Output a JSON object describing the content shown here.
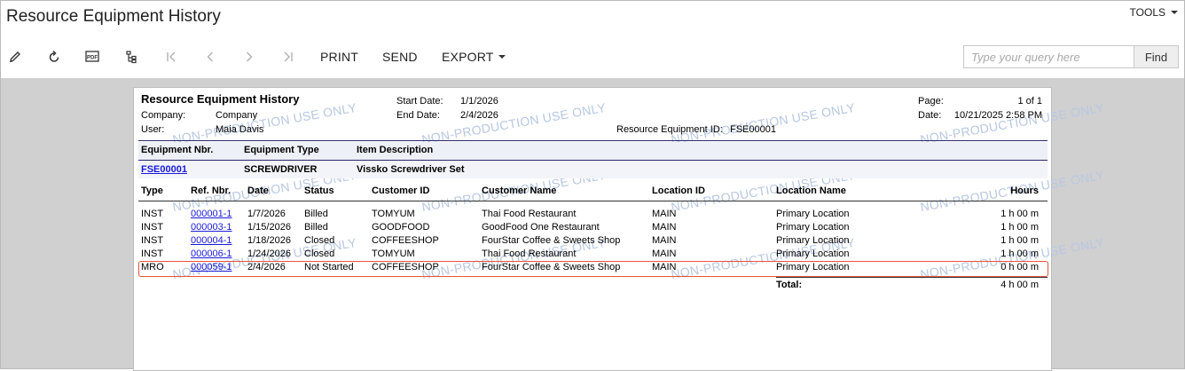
{
  "window": {
    "title": "Resource Equipment History",
    "tools_label": "TOOLS"
  },
  "toolbar": {
    "icons": [
      "edit-icon",
      "refresh-icon",
      "pdf-icon",
      "tree-icon",
      "first-icon",
      "previous-icon",
      "next-icon",
      "last-icon"
    ],
    "print_label": "PRINT",
    "send_label": "SEND",
    "export_label": "EXPORT",
    "search_placeholder": "Type your query here",
    "find_label": "Find"
  },
  "report": {
    "title": "Resource Equipment History",
    "watermark": "NON-PRODUCTION USE ONLY",
    "header": {
      "company_label": "Company:",
      "company_value": "Company",
      "user_label": "User:",
      "user_value": "Maia Davis",
      "start_label": "Start Date:",
      "start_value": "1/1/2026",
      "end_label": "End Date:",
      "end_value": "2/4/2026",
      "equip_id_label": "Resource Equipment ID:",
      "equip_id_value": "FSE00001",
      "page_label": "Page:",
      "page_value": "1 of 1",
      "date_label": "Date:",
      "date_value": "10/21/2025 2:58 PM"
    },
    "equipment_columns": [
      "Equipment Nbr.",
      "Equipment Type",
      "Item Description"
    ],
    "equipment": {
      "nbr": "FSE00001",
      "type": "SCREWDRIVER",
      "description": "Vissko Screwdriver Set"
    },
    "detail_columns": [
      "Type",
      "Ref. Nbr.",
      "Date",
      "Status",
      "Customer ID",
      "Customer Name",
      "Location ID",
      "Location Name",
      "Hours"
    ],
    "rows": [
      {
        "type": "INST",
        "ref": "000001-1",
        "date": "1/7/2026",
        "status": "Billed",
        "customer_id": "TOMYUM",
        "customer_name": "Thai Food Restaurant",
        "location_id": "MAIN",
        "location_name": "Primary Location",
        "hours": "1 h 00 m"
      },
      {
        "type": "INST",
        "ref": "000003-1",
        "date": "1/15/2026",
        "status": "Billed",
        "customer_id": "GOODFOOD",
        "customer_name": "GoodFood One Restaurant",
        "location_id": "MAIN",
        "location_name": "Primary Location",
        "hours": "1 h 00 m"
      },
      {
        "type": "INST",
        "ref": "000004-1",
        "date": "1/18/2026",
        "status": "Closed",
        "customer_id": "COFFEESHOP",
        "customer_name": "FourStar Coffee & Sweets Shop",
        "location_id": "MAIN",
        "location_name": "Primary Location",
        "hours": "1 h 00 m"
      },
      {
        "type": "INST",
        "ref": "000006-1",
        "date": "1/24/2026",
        "status": "Closed",
        "customer_id": "TOMYUM",
        "customer_name": "Thai Food Restaurant",
        "location_id": "MAIN",
        "location_name": "Primary Location",
        "hours": "1 h 00 m"
      },
      {
        "type": "MRO",
        "ref": "000059-1",
        "date": "2/4/2026",
        "status": "Not Started",
        "customer_id": "COFFEESHOP",
        "customer_name": "FourStar Coffee & Sweets Shop",
        "location_id": "MAIN",
        "location_name": "Primary Location",
        "hours": "0 h 00 m"
      }
    ],
    "total_label": "Total:",
    "total_value": "4 h 00 m"
  },
  "colors": {
    "link": "#1a1ad8",
    "highlight": "#e8553a",
    "watermark": "#b8c8e2",
    "band": "#eef0f8",
    "rule": "#2a2a6a"
  }
}
